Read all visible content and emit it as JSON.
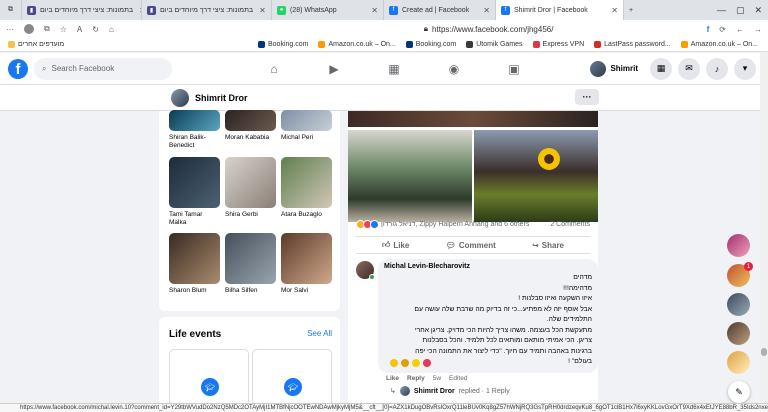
{
  "browser": {
    "tabs": [
      {
        "label": "בתמונות: ציצי דרך מיוחדים ביום",
        "icon_color": "#4a4a8a",
        "active": false
      },
      {
        "label": "בתמונות: ציצי דרך מיוחדים ביום",
        "icon_color": "#4a4a8a",
        "active": false
      },
      {
        "label": "(28) WhatsApp",
        "icon_color": "#25d366",
        "active": false
      },
      {
        "label": "Create ad | Facebook",
        "icon_color": "#1877f2",
        "active": false
      },
      {
        "label": "Shimrit Dror | Facebook",
        "icon_color": "#1877f2",
        "active": true
      }
    ],
    "url": "https://www.facebook.com/jhg456/",
    "bookmarks": [
      {
        "label": "מועדפים אחרים",
        "color": "#f2c14e"
      },
      {
        "label": "Booking.com",
        "color": "#003580"
      },
      {
        "label": "Amazon.co.uk – On...",
        "color": "#ff9900"
      },
      {
        "label": "Booking.com",
        "color": "#003580"
      },
      {
        "label": "Utomik Games",
        "color": "#3a3a3a"
      },
      {
        "label": "Express VPN",
        "color": "#da3940"
      },
      {
        "label": "LastPass password...",
        "color": "#d32d27"
      },
      {
        "label": "Amazon.co.uk – On...",
        "color": "#ff9900"
      }
    ],
    "status_url": "https://www.facebook.com/michal.levin.10?comment_id=Y29tbWVudDo2NzQ5MDc2OTAyMjI1MTBfNjcOOTEwNDAwMjkyMjM5&__cft__[0]=AZX1kDugOBvRsIOxrQ11leBUv0Kq8gZ57hWNjRQ3GsTpRH0drdzeqvKu8_6gOT1clB1Hx7l6xyKKLovGxOrT9Xd6x4xEtJYE88bR_35Ids2nxe_HUFm4..."
  },
  "fb": {
    "logo": "f",
    "search_placeholder": "Search Facebook",
    "profile_name": "Shimrit"
  },
  "profile": {
    "name": "Shimrit Dror",
    "more": "···"
  },
  "friends": [
    {
      "name": "Shiran Balik-Benedict",
      "color": "linear-gradient(135deg,#0c3b52,#5aa6c2)"
    },
    {
      "name": "Moran Kababia",
      "color": "linear-gradient(135deg,#2a2320,#6c5a4f)"
    },
    {
      "name": "Michal Peri",
      "color": "linear-gradient(135deg,#7d8fa5,#c8cfd6)"
    },
    {
      "name": "Tami Tamar Malka",
      "color": "linear-gradient(135deg,#1d2b3a,#4d6172)"
    },
    {
      "name": "Shira Gerbi",
      "color": "linear-gradient(135deg,#d8d3cc,#8a7f76)"
    },
    {
      "name": "Atara Buzaglo",
      "color": "linear-gradient(135deg,#5f7f4f,#d1c7b6)"
    },
    {
      "name": "Sharon Blum",
      "color": "linear-gradient(135deg,#3a2a22,#a88c6e)"
    },
    {
      "name": "Bilha Silfen",
      "color": "linear-gradient(135deg,#45505c,#9aa4ad)"
    },
    {
      "name": "Mor Salvi",
      "color": "linear-gradient(135deg,#5a3a2a,#d1a98a)"
    }
  ],
  "life_events": {
    "title": "Life events",
    "see_all": "See All"
  },
  "post": {
    "reactions_text": "דניאל גורדון, Zippy Halpern Anhang and 6 others",
    "comments_count": "2 Comments",
    "like": "Like",
    "comment": "Comment",
    "share": "Share"
  },
  "comment": {
    "author": "Michal Levin-Blecharovitz",
    "lines": [
      "מדהים",
      "מדהימה!!!",
      "איזו השקעה ואיזו סבלנות !",
      "אבל אוסף יזה לא מפתיע...כי זה בדיוק מה שרבת שלה עושה עם",
      "התלמידים שלה.",
      "מתעקשת הכל בעצמה. משהו צריך להיות הכי מדויק. צריגן אחרי",
      "צריגן. הכי אמיתי מותאם ומותאים לכל תלמיד. והכל בסבלנות",
      "ברגינות באהבה ותמיד עם חיוך. \"כדי ליצור את התמונה הכי יפה",
      "בעולם\" !"
    ],
    "like": "Like",
    "reply": "Reply",
    "time": "5w",
    "edited": "Edited",
    "reply_author": "Shimrit Dror",
    "reply_text": "replied · 1 Reply"
  },
  "contacts": [
    {
      "color": "linear-gradient(135deg,#a0306a,#f0a0c0)",
      "badge": ""
    },
    {
      "color": "linear-gradient(135deg,#c05030,#f0c060)",
      "badge": "1"
    },
    {
      "color": "linear-gradient(135deg,#3a4a5a,#9aaab5)",
      "badge": ""
    },
    {
      "color": "linear-gradient(135deg,#4a3a30,#c0a080)",
      "badge": ""
    },
    {
      "color": "linear-gradient(135deg,#e0a040,#fff0c0)",
      "badge": ""
    }
  ]
}
